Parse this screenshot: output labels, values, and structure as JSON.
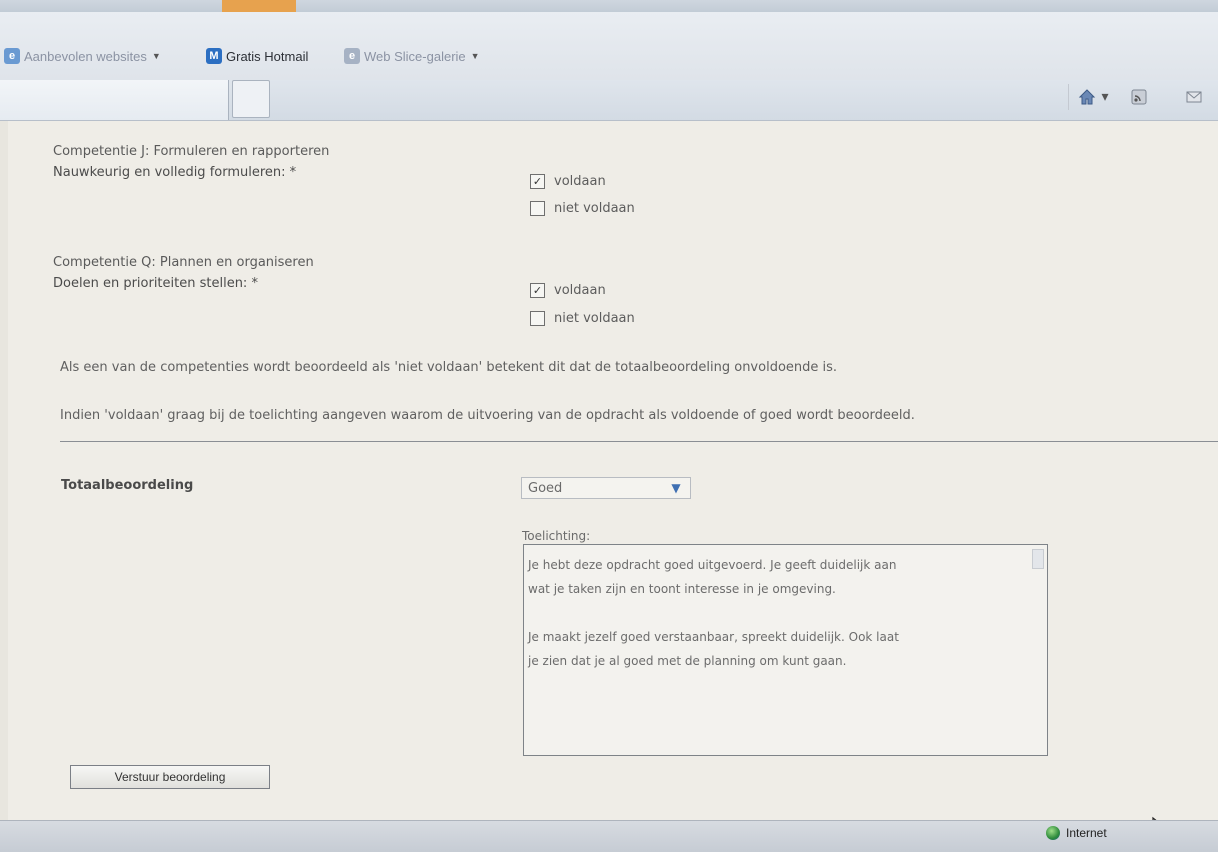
{
  "favorites": {
    "recommended": "Aanbevolen websites",
    "hotmail": "Gratis Hotmail",
    "webslice": "Web Slice-galerie"
  },
  "page": {
    "comp_j_title": "Competentie J: Formuleren en rapporteren",
    "comp_j_question": "Nauwkeurig en volledig formuleren: *",
    "comp_q_title": "Competentie Q: Plannen en organiseren",
    "comp_q_question": "Doelen en prioriteiten stellen: *",
    "opt_pass": "voldaan",
    "opt_fail": "niet voldaan",
    "comp_j_checked": "voldaan",
    "comp_q_checked": "voldaan",
    "note1": "Als een van de competenties wordt beoordeeld als 'niet voldaan' betekent dit dat de totaalbeoordeling onvoldoende is.",
    "note2": "Indien 'voldaan' graag bij de toelichting aangeven waarom de uitvoering van de opdracht als voldoende of goed wordt beoordeeld.",
    "total_label": "Totaalbeoordeling",
    "total_value": "Goed",
    "explanation_label": "Toelichting:",
    "explanation_lines": [
      "Je hebt deze opdracht goed uitgevoerd. Je geeft duidelijk aan",
      "wat je taken zijn en toont interesse in je omgeving.",
      "Je maakt jezelf goed verstaanbaar, spreekt duidelijk. Ook laat",
      "je zien dat je al goed met de planning om kunt gaan."
    ],
    "submit_label": "Verstuur beoordeling"
  },
  "status": {
    "zone": "Internet"
  },
  "icons": {
    "home": "home-icon",
    "feeds": "feeds-icon",
    "mail": "mail-icon"
  }
}
